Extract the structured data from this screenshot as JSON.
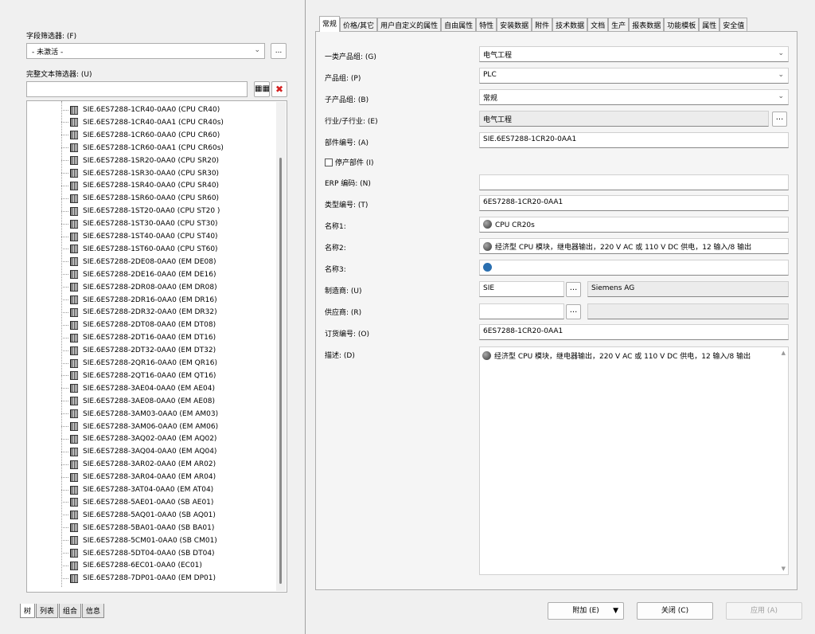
{
  "left": {
    "field_filter_label": "字段筛选器: (F)",
    "field_filter_value": "- 未激活 -",
    "field_filter_button": "...",
    "text_filter_label": "完整文本筛选器: (U)",
    "text_filter_value": "",
    "tree_items": [
      "SIE.6ES7288-1CR40-0AA0 (CPU CR40)",
      "SIE.6ES7288-1CR40-0AA1 (CPU CR40s)",
      "SIE.6ES7288-1CR60-0AA0 (CPU CR60)",
      "SIE.6ES7288-1CR60-0AA1 (CPU CR60s)",
      "SIE.6ES7288-1SR20-0AA0 (CPU SR20)",
      "SIE.6ES7288-1SR30-0AA0 (CPU SR30)",
      "SIE.6ES7288-1SR40-0AA0 (CPU SR40)",
      "SIE.6ES7288-1SR60-0AA0 (CPU SR60)",
      "SIE.6ES7288-1ST20-0AA0 (CPU ST20 )",
      "SIE.6ES7288-1ST30-0AA0 (CPU ST30)",
      "SIE.6ES7288-1ST40-0AA0 (CPU ST40)",
      "SIE.6ES7288-1ST60-0AA0 (CPU ST60)",
      "SIE.6ES7288-2DE08-0AA0 (EM DE08)",
      "SIE.6ES7288-2DE16-0AA0 (EM DE16)",
      "SIE.6ES7288-2DR08-0AA0 (EM DR08)",
      "SIE.6ES7288-2DR16-0AA0 (EM DR16)",
      "SIE.6ES7288-2DR32-0AA0 (EM DR32)",
      "SIE.6ES7288-2DT08-0AA0 (EM DT08)",
      "SIE.6ES7288-2DT16-0AA0 (EM DT16)",
      "SIE.6ES7288-2DT32-0AA0 (EM DT32)",
      "SIE.6ES7288-2QR16-0AA0 (EM QR16)",
      "SIE.6ES7288-2QT16-0AA0 (EM QT16)",
      "SIE.6ES7288-3AE04-0AA0 (EM AE04)",
      "SIE.6ES7288-3AE08-0AA0 (EM AE08)",
      "SIE.6ES7288-3AM03-0AA0 (EM AM03)",
      "SIE.6ES7288-3AM06-0AA0 (EM AM06)",
      "SIE.6ES7288-3AQ02-0AA0 (EM AQ02)",
      "SIE.6ES7288-3AQ04-0AA0 (EM AQ04)",
      "SIE.6ES7288-3AR02-0AA0 (EM AR02)",
      "SIE.6ES7288-3AR04-0AA0 (EM AR04)",
      "SIE.6ES7288-3AT04-0AA0 (EM AT04)",
      "SIE.6ES7288-5AE01-0AA0 (SB AE01)",
      "SIE.6ES7288-5AQ01-0AA0 (SB AQ01)",
      "SIE.6ES7288-5BA01-0AA0 (SB BA01)",
      "SIE.6ES7288-5CM01-0AA0 (SB CM01)",
      "SIE.6ES7288-5DT04-0AA0 (SB DT04)",
      "SIE.6ES7288-6EC01-0AA0 (EC01)",
      "SIE.6ES7288-7DP01-0AA0 (EM DP01)"
    ],
    "bottom_tabs": [
      "树",
      "列表",
      "组合",
      "信息"
    ]
  },
  "tabs": [
    "常规",
    "价格/其它",
    "用户自定义的属性",
    "自由属性",
    "特性",
    "安装数据",
    "附件",
    "技术数据",
    "文档",
    "生产",
    "报表数据",
    "功能模板",
    "属性",
    "安全值"
  ],
  "form": {
    "product_group_label": "一类产品组: (G)",
    "product_group_value": "电气工程",
    "group_label": "产品组: (P)",
    "group_value": "PLC",
    "subgroup_label": "子产品组: (B)",
    "subgroup_value": "常规",
    "industry_label": "行业/子行业: (E)",
    "industry_value": "电气工程",
    "part_number_label": "部件编号: (A)",
    "part_number_value": "SIE.6ES7288-1CR20-0AA1",
    "discontinued_label": "停产部件 (I)",
    "erp_label": "ERP 编码: (N)",
    "erp_value": "",
    "type_number_label": "类型编号: (T)",
    "type_number_value": "6ES7288-1CR20-0AA1",
    "name1_label": "名称1:",
    "name1_value": "CPU CR20s",
    "name2_label": "名称2:",
    "name2_value": "经济型 CPU 模块，继电器输出，220 V AC 或 110 V DC 供电，12 输入/8 输出",
    "name3_label": "名称3:",
    "name3_value": "",
    "manufacturer_label": "制造商: (U)",
    "manufacturer_code": "SIE",
    "manufacturer_name": "Siemens AG",
    "supplier_label": "供应商: (R)",
    "supplier_code": "",
    "supplier_name": "",
    "order_number_label": "订货编号: (O)",
    "order_number_value": "6ES7288-1CR20-0AA1",
    "description_label": "描述: (D)",
    "description_value": "经济型 CPU 模块，继电器输出，220 V AC 或 110 V DC 供电，12 输入/8 输出",
    "ellipsis": "..."
  },
  "footer": {
    "attach_label": "附加 (E)",
    "close_label": "关闭 (C)",
    "apply_label": "应用 (A)"
  }
}
